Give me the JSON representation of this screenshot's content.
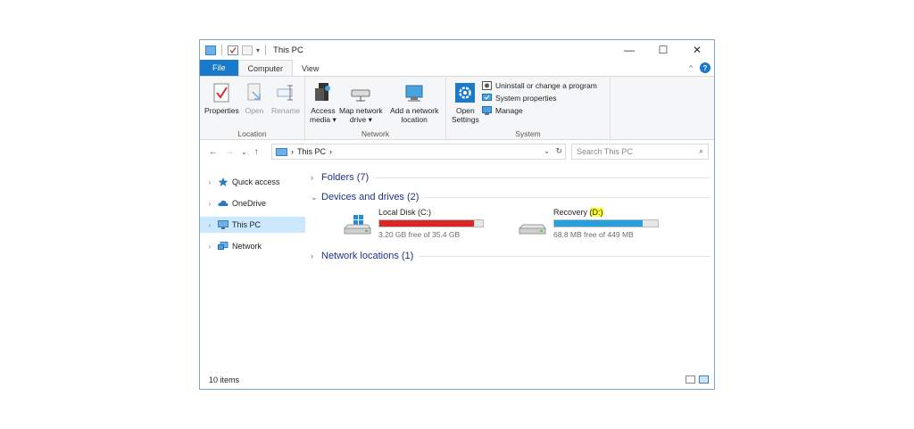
{
  "window": {
    "title": "This PC"
  },
  "window_controls": {
    "minimize": "—",
    "maximize": "☐",
    "close": "✕"
  },
  "tabs": [
    {
      "label": "File"
    },
    {
      "label": "Computer"
    },
    {
      "label": "View"
    }
  ],
  "ribbon": {
    "location": {
      "label": "Location",
      "properties": "Properties",
      "open": "Open",
      "rename": "Rename"
    },
    "network": {
      "label": "Network",
      "access_media": "Access\nmedia ▾",
      "access_media_l1": "Access",
      "access_media_l2": "media ▾",
      "map_drive_l1": "Map network",
      "map_drive_l2": "drive ▾",
      "add_location_l1": "Add a network",
      "add_location_l2": "location"
    },
    "system": {
      "label": "System",
      "open_settings_l1": "Open",
      "open_settings_l2": "Settings",
      "uninstall": "Uninstall or change a program",
      "system_properties": "System properties",
      "manage": "Manage"
    }
  },
  "address": {
    "back": "←",
    "forward": "→",
    "recent": "⌄",
    "up": "↑",
    "path_sep": "›",
    "path": "This PC",
    "path_end": "›",
    "dropdown": "⌄",
    "refresh": "↻"
  },
  "search": {
    "placeholder": "Search This PC",
    "icon": "⌕"
  },
  "nav_pane": [
    {
      "label": "Quick access",
      "icon": "star-icon"
    },
    {
      "label": "OneDrive",
      "icon": "cloud-icon"
    },
    {
      "label": "This PC",
      "icon": "computer-icon"
    },
    {
      "label": "Network",
      "icon": "network-icon"
    }
  ],
  "sections": {
    "folders": "Folders (7)",
    "devices": "Devices and drives (2)",
    "network_locations": "Network locations (1)"
  },
  "drives": [
    {
      "name": "Local Disk (C:)",
      "free": "3.20 GB free of 35.4 GB",
      "used_fraction": 0.91,
      "color": "#da2626"
    },
    {
      "name_prefix": "Recovery ",
      "name_highlight": "(D:)",
      "free": "68.8 MB free of 449 MB",
      "used_fraction": 0.85,
      "color": "#26a0da"
    }
  ],
  "status": {
    "item_count": "10 items"
  },
  "colors": {
    "accent": "#1979ca",
    "selected_bg": "#cce8ff",
    "section_text": "#1e3287"
  }
}
